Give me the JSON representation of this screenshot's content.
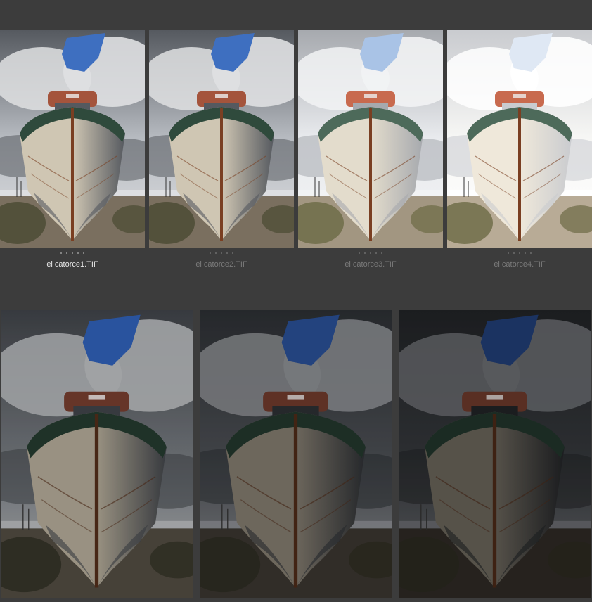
{
  "browser": {
    "top_row": [
      {
        "filename": "el catorce1.TIF",
        "selected": true,
        "rating_dots": 5,
        "exposure": 1.0
      },
      {
        "filename": "el catorce2.TIF",
        "selected": false,
        "rating_dots": 5,
        "exposure": 1.0
      },
      {
        "filename": "el catorce3.TIF",
        "selected": false,
        "rating_dots": 5,
        "exposure": 1.25
      },
      {
        "filename": "el catorce4.TIF",
        "selected": false,
        "rating_dots": 5,
        "exposure": 1.5
      }
    ],
    "bottom_row": [
      {
        "exposure": 0.8
      },
      {
        "exposure": 0.6
      },
      {
        "exposure": 0.45
      }
    ]
  },
  "colors": {
    "background": "#3c3c3c",
    "caption_active": "#e6e6e6",
    "caption_inactive": "#7a7a7a"
  }
}
